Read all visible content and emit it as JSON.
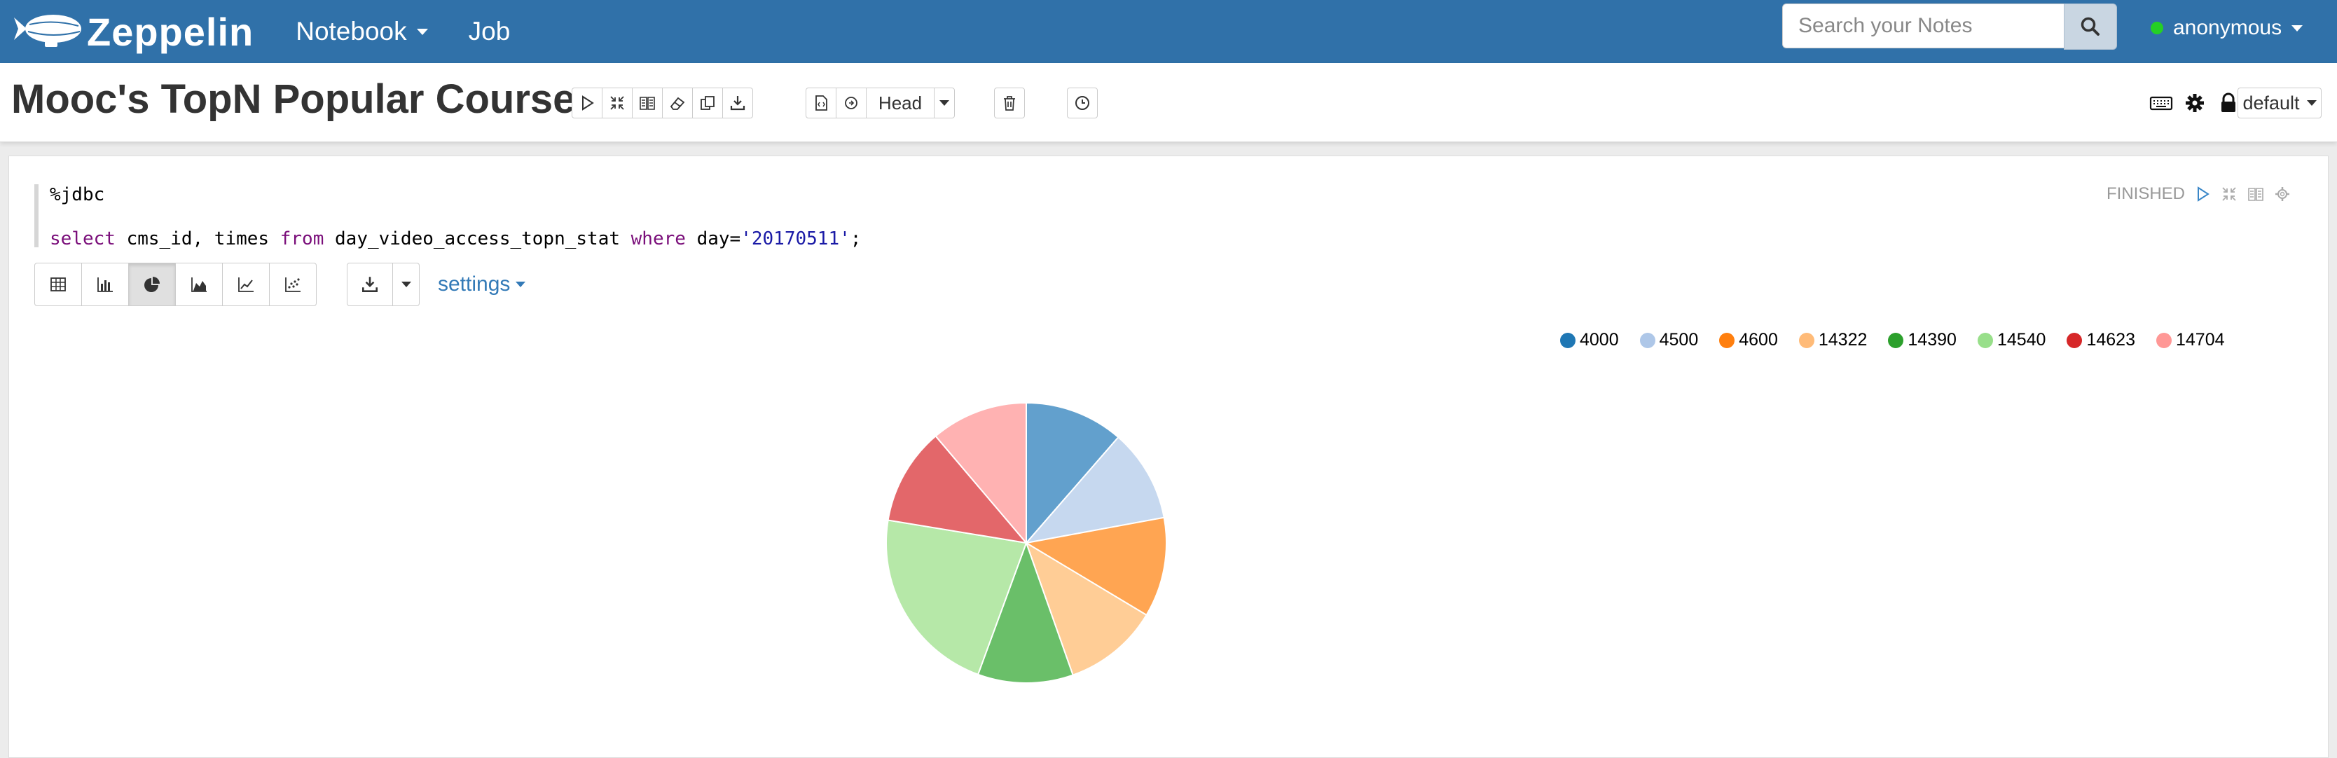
{
  "navbar": {
    "brand": "Zeppelin",
    "menu": [
      {
        "label": "Notebook",
        "has_caret": true
      },
      {
        "label": "Job",
        "has_caret": false
      }
    ],
    "search_placeholder": "Search your Notes",
    "user": "anonymous",
    "user_status_color": "#25d025",
    "background": "#3071a9"
  },
  "note": {
    "title": "Mooc's TopN Popular Course",
    "version_label": "Head",
    "interpreter_binding": "default"
  },
  "paragraph": {
    "interpreter": "%jdbc",
    "code": {
      "kw_select": "select",
      "cols": " cms_id, times ",
      "kw_from": "from",
      "table": " day_video_access_topn_stat ",
      "kw_where": "where",
      "cond": " day=",
      "value": "'20170511'",
      "end": ";"
    },
    "status": "FINISHED",
    "active_visualization": "pie",
    "settings_label": "settings"
  },
  "chart_data": {
    "type": "pie",
    "categories": [
      "4000",
      "4500",
      "4600",
      "14322",
      "14390",
      "14540",
      "14623",
      "14704"
    ],
    "values": [
      11.4,
      10.7,
      11.5,
      11.0,
      11.0,
      22.0,
      11.2,
      11.2
    ],
    "colors": [
      "#62a0cd",
      "#c6d8ef",
      "#ffa552",
      "#ffcd96",
      "#6abf69",
      "#b6e8a8",
      "#e3676a",
      "#ffb2b2"
    ],
    "legend_colors": [
      "#1f77b4",
      "#aec7e8",
      "#ff7f0e",
      "#ffbb78",
      "#2ca02c",
      "#98df8a",
      "#d62728",
      "#ff9896"
    ],
    "legend_position": "top-right",
    "start_angle_deg": 0,
    "direction": "clockwise"
  }
}
